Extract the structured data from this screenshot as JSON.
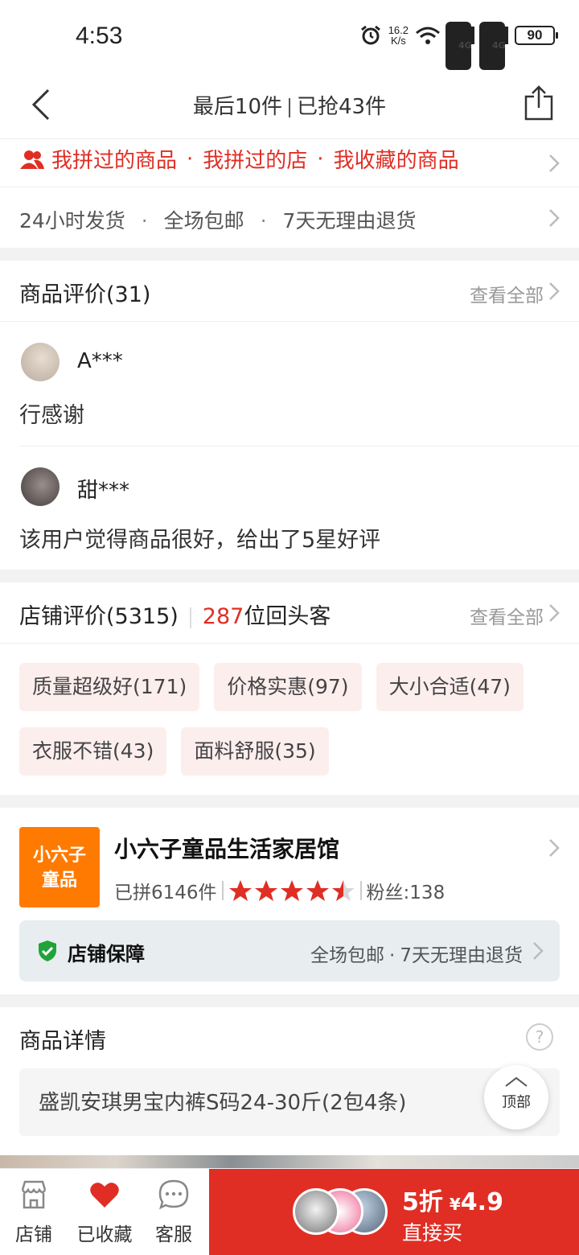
{
  "status_bar": {
    "time": "4:53",
    "net_speed_value": "16.2",
    "net_speed_unit": "K/s",
    "signal1": "4G",
    "signal2": "4G",
    "battery": "90"
  },
  "nav": {
    "title_left": "最后10件",
    "title_right": "已抢43件"
  },
  "links_row": {
    "items": [
      "我拼过的商品",
      "我拼过的店",
      "我收藏的商品"
    ],
    "sep": "·"
  },
  "ship_row": {
    "items": [
      "24小时发货",
      "全场包邮",
      "7天无理由退货"
    ],
    "sep": "·"
  },
  "reviews": {
    "title": "商品评价(31)",
    "see_all": "查看全部",
    "items": [
      {
        "user": "A***",
        "text": "行感谢"
      },
      {
        "user": "甜***",
        "text": "该用户觉得商品很好，给出了5星好评"
      }
    ]
  },
  "store_reviews": {
    "title": "店铺评价(5315)",
    "repeat_count": "287",
    "repeat_label": "位回头客",
    "see_all": "查看全部",
    "tags": [
      "质量超级好(171)",
      "价格实惠(97)",
      "大小合适(47)",
      "衣服不错(43)",
      "面料舒服(35)"
    ]
  },
  "store": {
    "logo_line1": "小六子",
    "logo_line2": "童品",
    "name": "小六子童品生活家居馆",
    "sold": "已拼6146件",
    "rating": 4.5,
    "fans": "粉丝:138",
    "guarantee_title": "店铺保障",
    "guarantee_items": [
      "全场包邮",
      "7天无理由退货"
    ],
    "sep": "·"
  },
  "details": {
    "title": "商品详情",
    "help": "?",
    "text": "盛凯安琪男宝内裤S码24-30斤(2包4条)"
  },
  "top_button": "顶部",
  "bottom_bar": {
    "shop": "店铺",
    "favorited": "已收藏",
    "service": "客服",
    "discount": "5折",
    "currency": "¥",
    "price": "4.9",
    "buy_label": "直接买"
  },
  "colors": {
    "brand_red": "#e02e24",
    "store_logo": "#ff7a00",
    "tag_bg": "#fdeeee",
    "shield_green": "#21a33c"
  }
}
